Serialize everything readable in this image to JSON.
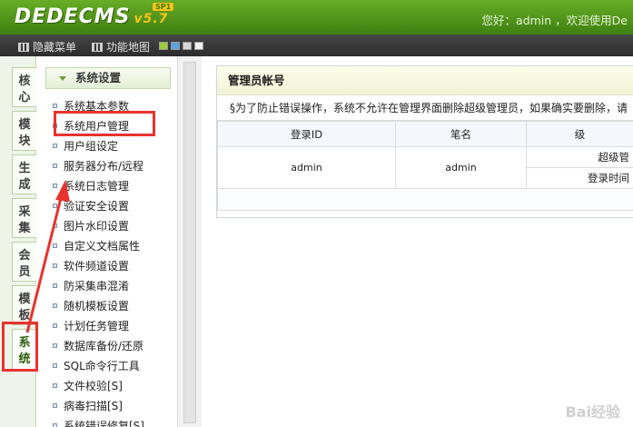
{
  "header": {
    "logo": "DEDECMS",
    "version": "v5.7",
    "badge": "SP1",
    "welcome": "您好：admin ，欢迎使用De"
  },
  "toolbar": {
    "hide_menu": "隐藏菜单",
    "sitemap": "功能地图",
    "swatch_colors": [
      "#9ccc3a",
      "#5aa1e6",
      "#d6d6d6",
      "#f1f1f1"
    ]
  },
  "vtabs": [
    {
      "label": "核心",
      "active": false
    },
    {
      "label": "模块",
      "active": false
    },
    {
      "label": "生成",
      "active": false
    },
    {
      "label": "采集",
      "active": false
    },
    {
      "label": "会员",
      "active": false
    },
    {
      "label": "模板",
      "active": false
    },
    {
      "label": "系统",
      "active": true
    }
  ],
  "menu": {
    "section_title": "系统设置",
    "items": [
      "系统基本参数",
      "系统用户管理",
      "用户组设定",
      "服务器分布/远程",
      "系统日志管理",
      "验证安全设置",
      "图片水印设置",
      "自定义文档属性",
      "软件频道设置",
      "防采集串混淆",
      "随机模板设置",
      "计划任务管理",
      "数据库备份/还原",
      "SQL命令行工具",
      "文件校验[S]",
      "病毒扫描[S]",
      "系统错误修复[S]"
    ]
  },
  "main": {
    "title": "管理员帐号",
    "notice": "§为了防止错误操作，系统不允许在管理界面删除超级管理员，如果确实要删除，请",
    "columns": [
      "登录ID",
      "笔名",
      "级"
    ],
    "rows": [
      {
        "login_id": "admin",
        "pen_name": "admin",
        "level": "超级管",
        "login_time": "登录时间"
      }
    ]
  },
  "annotation": {
    "highlight_color": "#e8332f"
  },
  "watermark": "Bai经验"
}
